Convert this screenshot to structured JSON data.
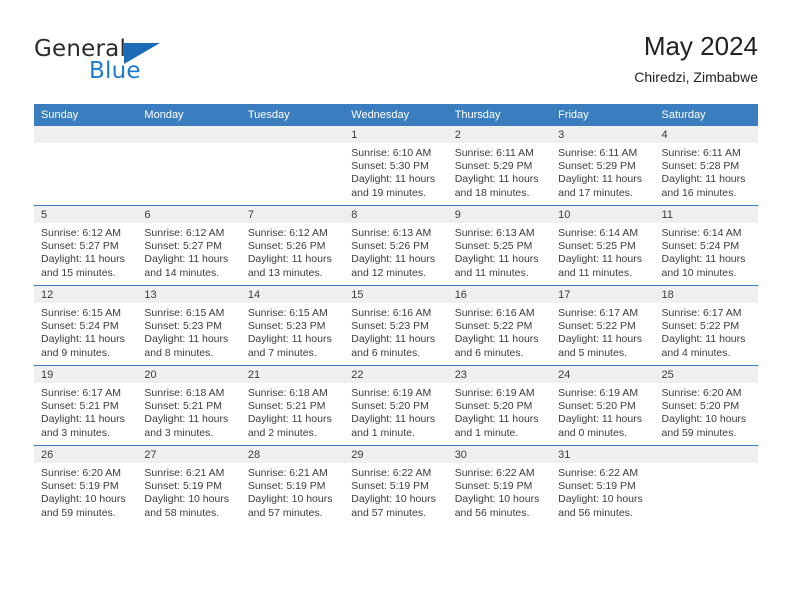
{
  "brand": {
    "name_top": "General",
    "name_bottom": "Blue",
    "accent_color": "#1d6bb5"
  },
  "header": {
    "title": "May 2024",
    "subtitle": "Chiredzi, Zimbabwe"
  },
  "calendar": {
    "header_bg": "#3a7ebf",
    "daynum_bg": "#efefef",
    "weekdays": [
      "Sunday",
      "Monday",
      "Tuesday",
      "Wednesday",
      "Thursday",
      "Friday",
      "Saturday"
    ],
    "weeks": [
      [
        {
          "day": "",
          "empty": true
        },
        {
          "day": "",
          "empty": true
        },
        {
          "day": "",
          "empty": true
        },
        {
          "day": "1",
          "sunrise": "Sunrise: 6:10 AM",
          "sunset": "Sunset: 5:30 PM",
          "daylight_line1": "Daylight: 11 hours",
          "daylight_line2": "and 19 minutes."
        },
        {
          "day": "2",
          "sunrise": "Sunrise: 6:11 AM",
          "sunset": "Sunset: 5:29 PM",
          "daylight_line1": "Daylight: 11 hours",
          "daylight_line2": "and 18 minutes."
        },
        {
          "day": "3",
          "sunrise": "Sunrise: 6:11 AM",
          "sunset": "Sunset: 5:29 PM",
          "daylight_line1": "Daylight: 11 hours",
          "daylight_line2": "and 17 minutes."
        },
        {
          "day": "4",
          "sunrise": "Sunrise: 6:11 AM",
          "sunset": "Sunset: 5:28 PM",
          "daylight_line1": "Daylight: 11 hours",
          "daylight_line2": "and 16 minutes."
        }
      ],
      [
        {
          "day": "5",
          "sunrise": "Sunrise: 6:12 AM",
          "sunset": "Sunset: 5:27 PM",
          "daylight_line1": "Daylight: 11 hours",
          "daylight_line2": "and 15 minutes."
        },
        {
          "day": "6",
          "sunrise": "Sunrise: 6:12 AM",
          "sunset": "Sunset: 5:27 PM",
          "daylight_line1": "Daylight: 11 hours",
          "daylight_line2": "and 14 minutes."
        },
        {
          "day": "7",
          "sunrise": "Sunrise: 6:12 AM",
          "sunset": "Sunset: 5:26 PM",
          "daylight_line1": "Daylight: 11 hours",
          "daylight_line2": "and 13 minutes."
        },
        {
          "day": "8",
          "sunrise": "Sunrise: 6:13 AM",
          "sunset": "Sunset: 5:26 PM",
          "daylight_line1": "Daylight: 11 hours",
          "daylight_line2": "and 12 minutes."
        },
        {
          "day": "9",
          "sunrise": "Sunrise: 6:13 AM",
          "sunset": "Sunset: 5:25 PM",
          "daylight_line1": "Daylight: 11 hours",
          "daylight_line2": "and 11 minutes."
        },
        {
          "day": "10",
          "sunrise": "Sunrise: 6:14 AM",
          "sunset": "Sunset: 5:25 PM",
          "daylight_line1": "Daylight: 11 hours",
          "daylight_line2": "and 11 minutes."
        },
        {
          "day": "11",
          "sunrise": "Sunrise: 6:14 AM",
          "sunset": "Sunset: 5:24 PM",
          "daylight_line1": "Daylight: 11 hours",
          "daylight_line2": "and 10 minutes."
        }
      ],
      [
        {
          "day": "12",
          "sunrise": "Sunrise: 6:15 AM",
          "sunset": "Sunset: 5:24 PM",
          "daylight_line1": "Daylight: 11 hours",
          "daylight_line2": "and 9 minutes."
        },
        {
          "day": "13",
          "sunrise": "Sunrise: 6:15 AM",
          "sunset": "Sunset: 5:23 PM",
          "daylight_line1": "Daylight: 11 hours",
          "daylight_line2": "and 8 minutes."
        },
        {
          "day": "14",
          "sunrise": "Sunrise: 6:15 AM",
          "sunset": "Sunset: 5:23 PM",
          "daylight_line1": "Daylight: 11 hours",
          "daylight_line2": "and 7 minutes."
        },
        {
          "day": "15",
          "sunrise": "Sunrise: 6:16 AM",
          "sunset": "Sunset: 5:23 PM",
          "daylight_line1": "Daylight: 11 hours",
          "daylight_line2": "and 6 minutes."
        },
        {
          "day": "16",
          "sunrise": "Sunrise: 6:16 AM",
          "sunset": "Sunset: 5:22 PM",
          "daylight_line1": "Daylight: 11 hours",
          "daylight_line2": "and 6 minutes."
        },
        {
          "day": "17",
          "sunrise": "Sunrise: 6:17 AM",
          "sunset": "Sunset: 5:22 PM",
          "daylight_line1": "Daylight: 11 hours",
          "daylight_line2": "and 5 minutes."
        },
        {
          "day": "18",
          "sunrise": "Sunrise: 6:17 AM",
          "sunset": "Sunset: 5:22 PM",
          "daylight_line1": "Daylight: 11 hours",
          "daylight_line2": "and 4 minutes."
        }
      ],
      [
        {
          "day": "19",
          "sunrise": "Sunrise: 6:17 AM",
          "sunset": "Sunset: 5:21 PM",
          "daylight_line1": "Daylight: 11 hours",
          "daylight_line2": "and 3 minutes."
        },
        {
          "day": "20",
          "sunrise": "Sunrise: 6:18 AM",
          "sunset": "Sunset: 5:21 PM",
          "daylight_line1": "Daylight: 11 hours",
          "daylight_line2": "and 3 minutes."
        },
        {
          "day": "21",
          "sunrise": "Sunrise: 6:18 AM",
          "sunset": "Sunset: 5:21 PM",
          "daylight_line1": "Daylight: 11 hours",
          "daylight_line2": "and 2 minutes."
        },
        {
          "day": "22",
          "sunrise": "Sunrise: 6:19 AM",
          "sunset": "Sunset: 5:20 PM",
          "daylight_line1": "Daylight: 11 hours",
          "daylight_line2": "and 1 minute."
        },
        {
          "day": "23",
          "sunrise": "Sunrise: 6:19 AM",
          "sunset": "Sunset: 5:20 PM",
          "daylight_line1": "Daylight: 11 hours",
          "daylight_line2": "and 1 minute."
        },
        {
          "day": "24",
          "sunrise": "Sunrise: 6:19 AM",
          "sunset": "Sunset: 5:20 PM",
          "daylight_line1": "Daylight: 11 hours",
          "daylight_line2": "and 0 minutes."
        },
        {
          "day": "25",
          "sunrise": "Sunrise: 6:20 AM",
          "sunset": "Sunset: 5:20 PM",
          "daylight_line1": "Daylight: 10 hours",
          "daylight_line2": "and 59 minutes."
        }
      ],
      [
        {
          "day": "26",
          "sunrise": "Sunrise: 6:20 AM",
          "sunset": "Sunset: 5:19 PM",
          "daylight_line1": "Daylight: 10 hours",
          "daylight_line2": "and 59 minutes."
        },
        {
          "day": "27",
          "sunrise": "Sunrise: 6:21 AM",
          "sunset": "Sunset: 5:19 PM",
          "daylight_line1": "Daylight: 10 hours",
          "daylight_line2": "and 58 minutes."
        },
        {
          "day": "28",
          "sunrise": "Sunrise: 6:21 AM",
          "sunset": "Sunset: 5:19 PM",
          "daylight_line1": "Daylight: 10 hours",
          "daylight_line2": "and 57 minutes."
        },
        {
          "day": "29",
          "sunrise": "Sunrise: 6:22 AM",
          "sunset": "Sunset: 5:19 PM",
          "daylight_line1": "Daylight: 10 hours",
          "daylight_line2": "and 57 minutes."
        },
        {
          "day": "30",
          "sunrise": "Sunrise: 6:22 AM",
          "sunset": "Sunset: 5:19 PM",
          "daylight_line1": "Daylight: 10 hours",
          "daylight_line2": "and 56 minutes."
        },
        {
          "day": "31",
          "sunrise": "Sunrise: 6:22 AM",
          "sunset": "Sunset: 5:19 PM",
          "daylight_line1": "Daylight: 10 hours",
          "daylight_line2": "and 56 minutes."
        },
        {
          "day": "",
          "empty": true
        }
      ]
    ]
  }
}
